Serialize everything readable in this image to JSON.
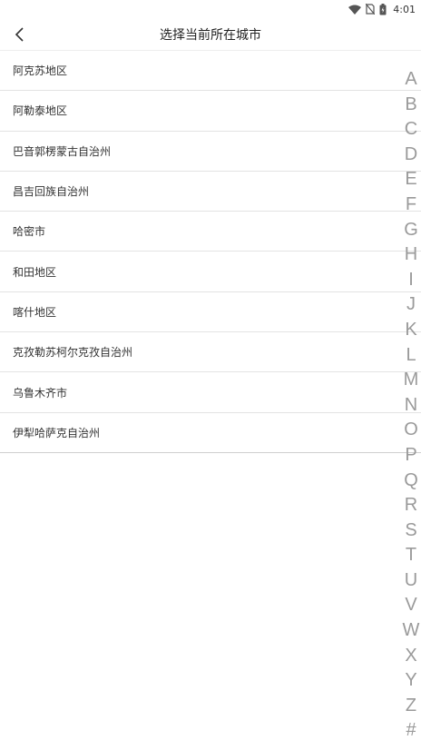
{
  "status_bar": {
    "time": "4:01"
  },
  "header": {
    "title": "选择当前所在城市"
  },
  "cities": [
    "阿克苏地区",
    "阿勒泰地区",
    "巴音郭楞蒙古自治州",
    "昌吉回族自治州",
    "哈密市",
    "和田地区",
    "喀什地区",
    "克孜勒苏柯尔克孜自治州",
    "乌鲁木齐市",
    "伊犁哈萨克自治州"
  ],
  "alphabet_index": [
    "A",
    "B",
    "C",
    "D",
    "E",
    "F",
    "G",
    "H",
    "I",
    "J",
    "K",
    "L",
    "M",
    "N",
    "O",
    "P",
    "Q",
    "R",
    "S",
    "T",
    "U",
    "V",
    "W",
    "X",
    "Y",
    "Z",
    "#"
  ]
}
